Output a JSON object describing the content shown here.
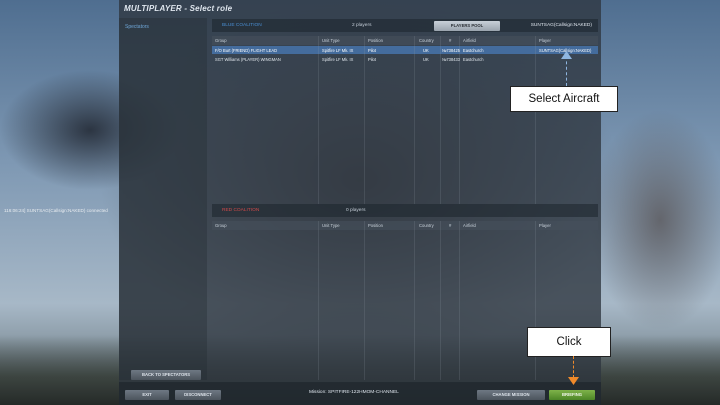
{
  "window": {
    "title": "MULTIPLAYER - Select role",
    "log_line": "116:06:24] SUNTSAG(Callsign:NAKED) connected"
  },
  "left_column": {
    "spectators_label": "Spectators",
    "back_button": "BACK TO SPECTATORS"
  },
  "blue": {
    "name": "BLUE COALITION",
    "count": "2 players",
    "pool_button": "PLAYERS POOL",
    "player_header": "SUNTSAG(Callsign:NAKED)",
    "columns": [
      "Group",
      "Unit Type",
      "Position",
      "Country",
      "#",
      "Airfield",
      "Player"
    ],
    "rows": [
      {
        "group": "F/O Burt (FRIEND) FLIGHT LEAD",
        "unit": "Spitfire LF Mk. IX",
        "position": "Pilot",
        "country": "UK",
        "num": "№738425",
        "airfield": "Eastchurch",
        "player": "SUNTSAG(Callsign:NAKED)"
      },
      {
        "group": "SGT Williams (PLAYER) WINGMAN",
        "unit": "Spitfire LF Mk. IX",
        "position": "Pilot",
        "country": "UK",
        "num": "№738433",
        "airfield": "Eastchurch",
        "player": ""
      }
    ]
  },
  "red": {
    "name": "RED COALITION",
    "count": "0 players",
    "columns": [
      "Group",
      "Unit Type",
      "Position",
      "Country",
      "#",
      "Airfield",
      "Player"
    ]
  },
  "bottom": {
    "exit": "EXIT",
    "disconnect": "DISCONNECT",
    "mission": "Mission: SPITFIRE-122HMOM-CHANNEL",
    "change_mission": "CHANGE MISSION",
    "briefing": "BRIEFING"
  },
  "annotations": {
    "select_aircraft": "Select Aircraft",
    "click": "Click"
  },
  "colors": {
    "blue_coalition": "#4a8fd4",
    "red_coalition": "#d04a4a",
    "selection": "#4673aa",
    "briefing_green": "#5e9a34",
    "arrow_blue": "#8fb6e0",
    "arrow_orange": "#f08a2a"
  }
}
